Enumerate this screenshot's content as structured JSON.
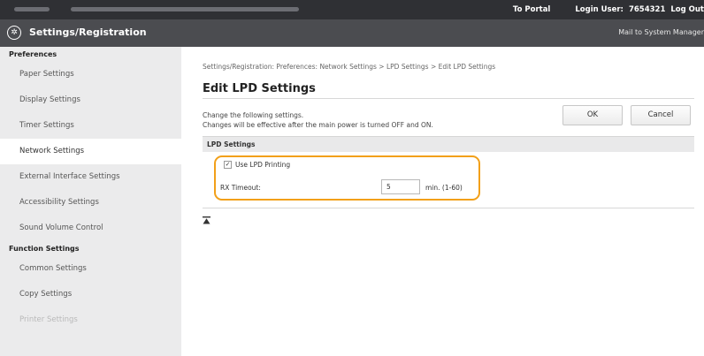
{
  "topbar": {
    "portal_link": "To Portal",
    "login_label": "Login User:",
    "login_user": "7654321",
    "logout": "Log Out"
  },
  "header": {
    "logo_icon": "gear-emblem-icon",
    "title": "Settings/Registration",
    "mail_link": "Mail to System Manager"
  },
  "sidebar": {
    "sections": [
      {
        "label": "Preferences",
        "items": [
          {
            "label": "Paper Settings"
          },
          {
            "label": "Display Settings"
          },
          {
            "label": "Timer Settings"
          },
          {
            "label": "Network Settings",
            "active": true
          },
          {
            "label": "External Interface Settings"
          },
          {
            "label": "Accessibility Settings"
          },
          {
            "label": "Sound Volume Control"
          }
        ]
      },
      {
        "label": "Function Settings",
        "items": [
          {
            "label": "Common Settings"
          },
          {
            "label": "Copy Settings"
          },
          {
            "label": "Printer Settings"
          }
        ]
      }
    ]
  },
  "main": {
    "breadcrumb": "Settings/Registration: Preferences: Network Settings > LPD Settings > Edit LPD Settings",
    "title": "Edit LPD Settings",
    "description_line1": "Change the following settings.",
    "description_line2": "Changes will be effective after the main power is turned OFF and ON.",
    "ok_label": "OK",
    "cancel_label": "Cancel",
    "section_title": "LPD Settings",
    "use_lpd_label": "Use LPD Printing",
    "use_lpd_checked": true,
    "rx_timeout_label": "RX Timeout:",
    "rx_timeout_value": "5",
    "rx_timeout_unit": "min. (1-60)",
    "highlight_color": "#f2a019"
  },
  "colors": {
    "topbar": "#2f3034",
    "titlebar": "#4b4c50",
    "sidebar": "#ebebec"
  }
}
